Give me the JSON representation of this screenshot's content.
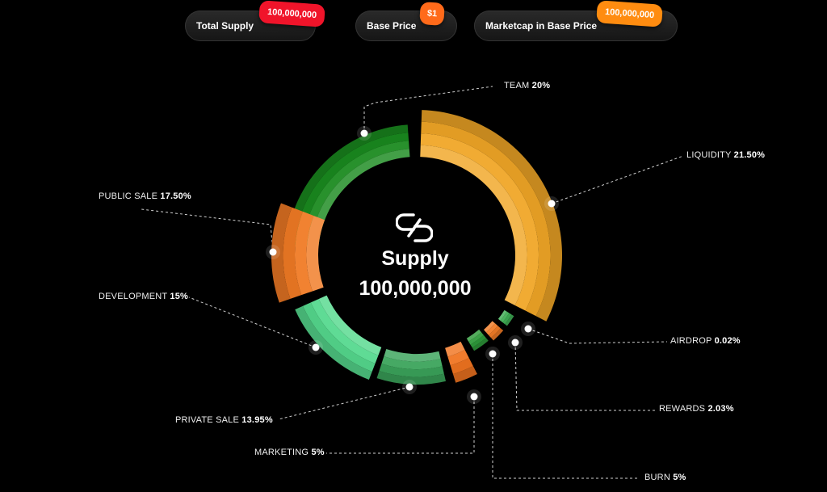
{
  "header": {
    "total_supply": {
      "label": "Total Supply",
      "value": "100,000,000"
    },
    "base_price": {
      "label": "Base Price",
      "value": "$1"
    },
    "marketcap": {
      "label": "Marketcap in Base Price",
      "value": "100,000,000"
    }
  },
  "center": {
    "title": "Supply",
    "value": "100,000,000",
    "icon": "logo-icon"
  },
  "colors": {
    "red": "#f0142a",
    "orange": "#ff7a1a",
    "amber": "#ff8c10"
  },
  "chart_data": {
    "type": "pie",
    "title": "Supply",
    "slices": [
      {
        "name": "TEAM",
        "label": "TEAM",
        "pct": "20%",
        "value": 20,
        "color": "#1a8a1f"
      },
      {
        "name": "LIQUIDITY",
        "label": "LIQUIDITY",
        "pct": "21.50%",
        "value": 21.5,
        "color": "#f0a626"
      },
      {
        "name": "AIRDROP",
        "label": "AIRDROP",
        "pct": "0.02%",
        "value": 0.02,
        "color": "#3fae55"
      },
      {
        "name": "REWARDS",
        "label": "REWARDS",
        "pct": "2.03%",
        "value": 2.03,
        "color": "#f07b26"
      },
      {
        "name": "BURN",
        "label": "BURN",
        "pct": "5%",
        "value": 5,
        "color": "#2e9a3a"
      },
      {
        "name": "MARKETING",
        "label": "MARKETING",
        "pct": "5%",
        "value": 5,
        "color": "#f07420"
      },
      {
        "name": "PRIVATE SALE",
        "label": "PRIVATE SALE",
        "pct": "13.95%",
        "value": 13.95,
        "color": "#3aa35a"
      },
      {
        "name": "DEVELOPMENT",
        "label": "DEVELOPMENT",
        "pct": "15%",
        "value": 15,
        "color": "#55d98e"
      },
      {
        "name": "PUBLIC SALE",
        "label": "PUBLIC SALE",
        "pct": "17.50%",
        "value": 17.5,
        "color": "#f07a24"
      }
    ]
  }
}
